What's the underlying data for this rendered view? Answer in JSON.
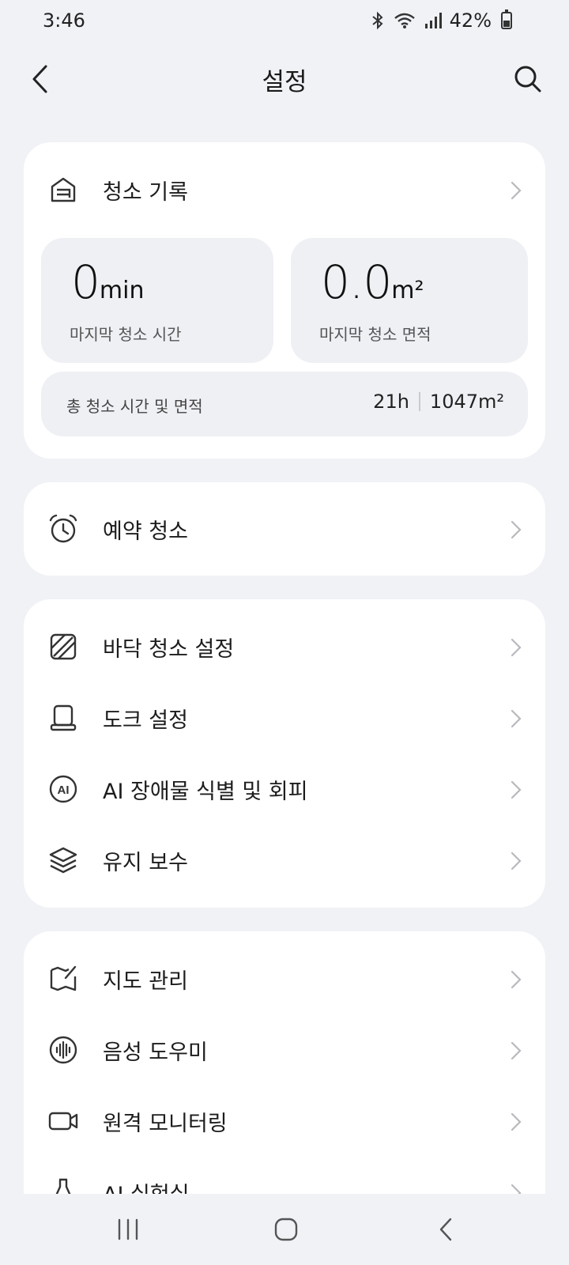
{
  "status_bar": {
    "time": "3:46",
    "battery": "42%",
    "battery_level": 0.42
  },
  "header": {
    "title": "설정"
  },
  "cleaning_record": {
    "label": "청소 기록",
    "last_time_value": "0",
    "last_time_unit": "min",
    "last_time_label": "마지막 청소 시간",
    "last_area_value": "0.0",
    "last_area_unit": "m²",
    "last_area_label": "마지막 청소 면적",
    "total_label": "총 청소 시간 및 면적",
    "total_time": "21h",
    "total_area": "1047m²"
  },
  "schedule": {
    "label": "예약 청소"
  },
  "settings_group": [
    {
      "label": "바닥 청소 설정",
      "icon": "floor-icon"
    },
    {
      "label": "도크 설정",
      "icon": "dock-icon"
    },
    {
      "label": "AI 장애물 식별 및 회피",
      "icon": "ai-icon"
    },
    {
      "label": "유지 보수",
      "icon": "layers-icon"
    }
  ],
  "tools_group": [
    {
      "label": "지도 관리",
      "icon": "map-icon"
    },
    {
      "label": "음성 도우미",
      "icon": "voice-icon"
    },
    {
      "label": "원격 모니터링",
      "icon": "camera-icon"
    },
    {
      "label": "AI 실험실",
      "icon": "flask-icon"
    }
  ]
}
